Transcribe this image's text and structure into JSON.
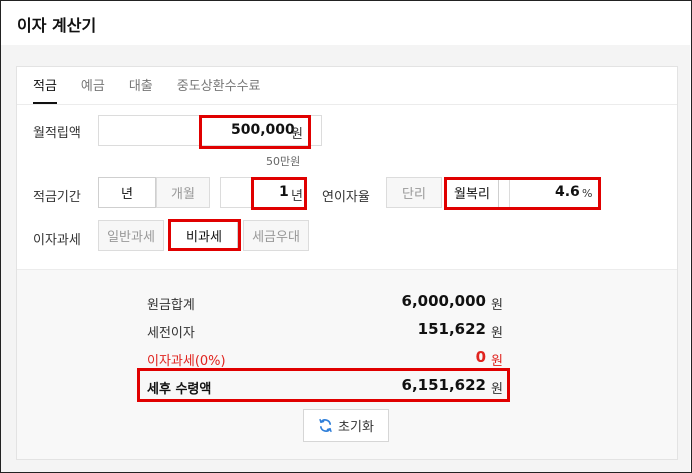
{
  "header": {
    "title": "이자 계산기"
  },
  "tabs": [
    {
      "label": "적금",
      "active": true
    },
    {
      "label": "예금",
      "active": false
    },
    {
      "label": "대출",
      "active": false
    },
    {
      "label": "중도상환수수료",
      "active": false
    }
  ],
  "monthly_deposit": {
    "label": "월적립액",
    "value": "500,000",
    "unit": "원",
    "hint": "50만원"
  },
  "period": {
    "label": "적금기간",
    "unit_year": "년",
    "unit_month": "개월",
    "value": "1",
    "value_unit": "년"
  },
  "rate": {
    "label": "연이자율",
    "simple": "단리",
    "compound": "월복리",
    "value": "4.6",
    "unit": "%"
  },
  "tax": {
    "label": "이자과세",
    "options": [
      "일반과세",
      "비과세",
      "세금우대"
    ],
    "selected": "비과세"
  },
  "results": {
    "principal": {
      "label": "원금합계",
      "value": "6,000,000",
      "unit": "원"
    },
    "pretax_interest": {
      "label": "세전이자",
      "value": "151,622",
      "unit": "원"
    },
    "interest_tax": {
      "label": "이자과세(0%)",
      "value": "0",
      "unit": "원"
    },
    "after_tax": {
      "label": "세후 수령액",
      "value": "6,151,622",
      "unit": "원"
    }
  },
  "reset_label": "초기화",
  "colors": {
    "highlight": "#e00000",
    "tax_red": "#e0241f"
  }
}
